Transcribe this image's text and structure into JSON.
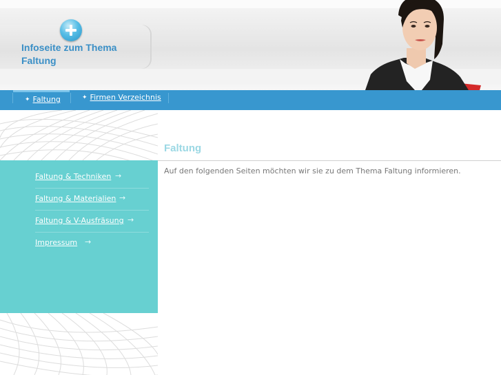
{
  "header": {
    "site_title": "Infoseite zum Thema Faltung",
    "logo_icon": "plus-circle-icon"
  },
  "nav": {
    "items": [
      {
        "label": "Faltung",
        "active": true
      },
      {
        "label": "Firmen Verzeichnis",
        "active": false
      }
    ],
    "bullet_icon": "star-bullet-icon"
  },
  "sidebar": {
    "items": [
      {
        "label": "Faltung & Techniken"
      },
      {
        "label": "Faltung & Materialien"
      },
      {
        "label": "Faltung & V-Ausfräsung"
      },
      {
        "label": "Impressum"
      }
    ],
    "arrow_icon": "arrow-right-icon"
  },
  "content": {
    "title": "Faltung",
    "text": "Auf den folgenden Seiten möchten wir sie zu dem Thema Faltung informieren."
  },
  "colors": {
    "nav_blue": "#3897cf",
    "sidebar_teal": "#67d0d1",
    "title_blue": "#3a8fc6",
    "heading_light": "#9bd8e4"
  }
}
